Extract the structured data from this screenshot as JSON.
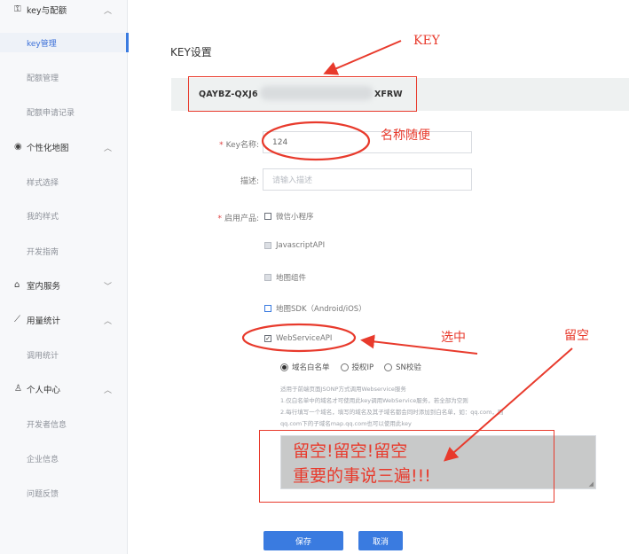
{
  "sidebar": {
    "groups": [
      {
        "label": "key与配额",
        "icon": "key-icon",
        "glyph": "⚿",
        "chevron": "︿",
        "items": [
          {
            "label": "key管理",
            "active": true
          },
          {
            "label": "配额管理"
          },
          {
            "label": "配额申请记录"
          }
        ]
      },
      {
        "label": "个性化地图",
        "icon": "eye-icon",
        "glyph": "◉",
        "chevron": "︿",
        "items": [
          {
            "label": "样式选择"
          },
          {
            "label": "我的样式"
          },
          {
            "label": "开发指南"
          }
        ]
      },
      {
        "label": "室内服务",
        "icon": "home-icon",
        "glyph": "⌂",
        "chevron": "﹀",
        "items": []
      },
      {
        "label": "用量统计",
        "icon": "chart-icon",
        "glyph": "⟋",
        "chevron": "︿",
        "items": [
          {
            "label": "调用统计"
          }
        ]
      },
      {
        "label": "个人中心",
        "icon": "user-icon",
        "glyph": "♙",
        "chevron": "︿",
        "items": [
          {
            "label": "开发者信息"
          },
          {
            "label": "企业信息"
          },
          {
            "label": "问题反馈"
          }
        ]
      }
    ]
  },
  "main": {
    "title": "KEY设置",
    "key_prefix": "QAYBZ-QXJ6",
    "key_suffix": "XFRW",
    "form": {
      "key_name_label": "Key名称:",
      "key_name_value": "124",
      "desc_label": "描述:",
      "desc_placeholder": "请输入描述",
      "products_label": "启用产品:",
      "products": [
        {
          "label": "微信小程序",
          "state": "unchecked"
        },
        {
          "label": "JavascriptAPI",
          "state": "disabled"
        },
        {
          "label": "地图组件",
          "state": "disabled"
        },
        {
          "label": "地图SDK（Android/iOS）",
          "state": "unchecked-blue"
        },
        {
          "label": "WebServiceAPI",
          "state": "checked"
        }
      ],
      "radios": [
        {
          "label": "域名白名单",
          "selected": true
        },
        {
          "label": "授权IP",
          "selected": false
        },
        {
          "label": "SN校验",
          "selected": false
        }
      ],
      "help_lines": [
        "适用于前端页面JSONP方式调用Webservice服务",
        "1.仅白名单中的域名才可使用此key调用WebService服务，若全部为空则",
        "2.每行填写一个域名，填写的域名及其子域名都会同时添加到白名单，如：qq.com，则",
        "qq.com下的子域名map.qq.com也可以使用此key"
      ],
      "textarea_grip": "◢",
      "save_label": "保存",
      "cancel_label": "取消"
    }
  },
  "annotations": {
    "key": "KEY",
    "name_note": "名称随便",
    "select_note": "选中",
    "blank_note": "留空",
    "big_line1": "留空!留空!留空",
    "big_line2": "重要的事说三遍!!!"
  },
  "colors": {
    "accent": "#3a7be0",
    "annotation": "#e83a2c"
  }
}
